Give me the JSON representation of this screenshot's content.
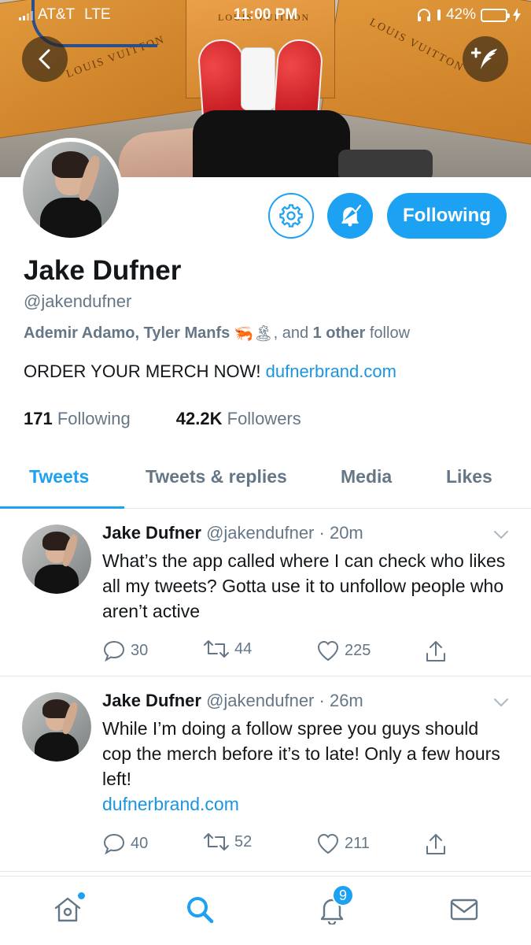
{
  "status_bar": {
    "carrier": "AT&T",
    "network": "LTE",
    "time": "11:00 PM",
    "battery": "42%",
    "battery_level": 0.42
  },
  "banner": {
    "box_text_left": "LOUIS VUITTON",
    "box_text_center": "LOUIS VUITTON",
    "box_text_right": "LOUIS VUITTON"
  },
  "header": {
    "back_icon": "back-chevron-icon",
    "compose_icon": "compose-tweet-icon"
  },
  "profile": {
    "name": "Jake Dufner",
    "handle": "@jakendufner",
    "followed_by": {
      "names": "Ademir Adamo, Tyler Manfs",
      "emoji": "🦐🏝",
      "and_text": ", and",
      "other_count": "1 other",
      "suffix": "follow"
    },
    "bio_text": "ORDER YOUR MERCH NOW!",
    "bio_link": "dufnerbrand.com",
    "following_count": "171",
    "following_label": "Following",
    "followers_count": "42.2K",
    "followers_label": "Followers",
    "follow_button_label": "Following"
  },
  "tabs": [
    {
      "label": "Tweets",
      "active": true
    },
    {
      "label": "Tweets & replies",
      "active": false
    },
    {
      "label": "Media",
      "active": false
    },
    {
      "label": "Likes",
      "active": false
    }
  ],
  "tweets": [
    {
      "name": "Jake Dufner",
      "handle": "@jakendufner",
      "time": "20m",
      "text": "What’s the app called where I can check who likes all my tweets? Gotta use it to unfollow people who aren’t active",
      "link": "",
      "replies": "30",
      "retweets": "44",
      "likes": "225"
    },
    {
      "name": "Jake Dufner",
      "handle": "@jakendufner",
      "time": "26m",
      "text": "While I’m doing a follow spree you guys should cop the merch before it’s to late! Only a few hours left!",
      "link": "dufnerbrand.com",
      "replies": "40",
      "retweets": "52",
      "likes": "211"
    }
  ],
  "bottom_nav": {
    "notifications_badge": "9"
  },
  "colors": {
    "accent": "#1da1f2",
    "link": "#1b95e0",
    "secondary_text": "#657786",
    "divider": "#e1e8ed"
  }
}
